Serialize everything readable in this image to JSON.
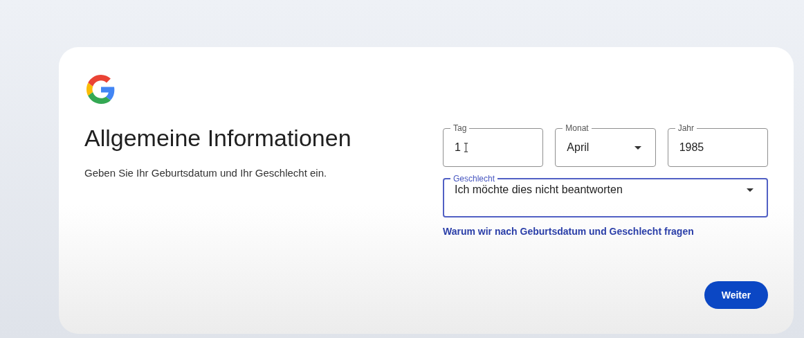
{
  "title": "Allgemeine Informationen",
  "subtitle": "Geben Sie Ihr Geburtsdatum und Ihr Geschlecht ein.",
  "date_fields": [
    {
      "label": "Tag",
      "value": "1",
      "kind": "text",
      "focused": false
    },
    {
      "label": "Monat",
      "value": "April",
      "kind": "select",
      "focused": false
    },
    {
      "label": "Jahr",
      "value": "1985",
      "kind": "text",
      "focused": false
    }
  ],
  "gender_field": {
    "label": "Geschlecht",
    "value": "Ich möchte dies nicht beantworten",
    "kind": "select",
    "focused": true
  },
  "help_link": "Warum wir nach Geburtsdatum und Geschlecht fragen",
  "next_button": "Weiter"
}
